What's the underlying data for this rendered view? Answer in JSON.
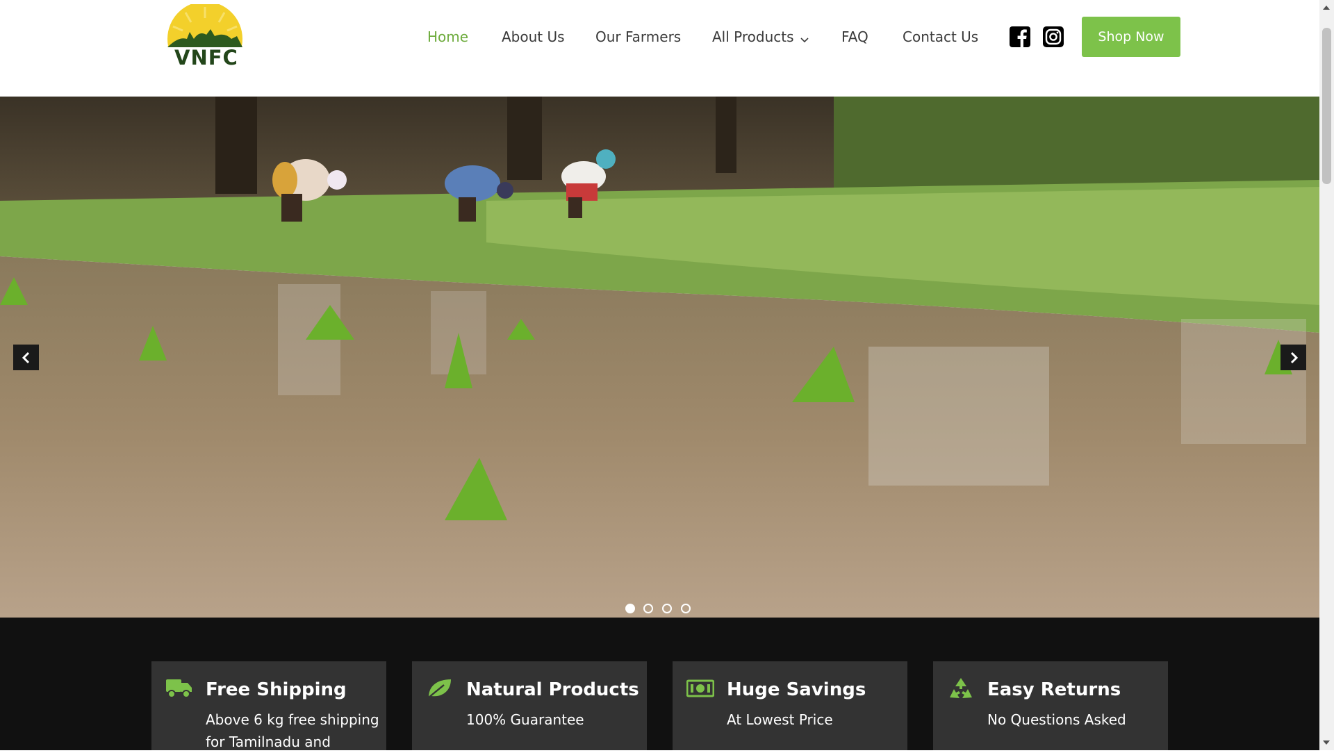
{
  "brand": {
    "name": "VNFC"
  },
  "nav": {
    "items": [
      {
        "label": "Home"
      },
      {
        "label": "About Us"
      },
      {
        "label": "Our Farmers"
      },
      {
        "label": "All Products"
      },
      {
        "label": "FAQ"
      },
      {
        "label": "Contact Us"
      }
    ],
    "active_index": 0,
    "social_icons": [
      "facebook-icon",
      "instagram-icon"
    ],
    "shop_button": "Shop Now"
  },
  "hero": {
    "slides": 4,
    "active_slide": 1,
    "prev_icon": "chevron-left-icon",
    "next_icon": "chevron-right-icon"
  },
  "features": [
    {
      "icon": "truck-icon",
      "title": "Free Shipping",
      "subtitle": "Above 6 kg free shipping for Tamilnadu and"
    },
    {
      "icon": "leaf-icon",
      "title": "Natural Products",
      "subtitle": "100% Guarantee"
    },
    {
      "icon": "money-icon",
      "title": "Huge Savings",
      "subtitle": "At Lowest Price"
    },
    {
      "icon": "recycle-icon",
      "title": "Easy Returns",
      "subtitle": "No Questions Asked"
    }
  ],
  "colors": {
    "accent": "#7dc24a",
    "active_nav": "#6dab3c",
    "band": "#111111",
    "card": "#333333"
  }
}
